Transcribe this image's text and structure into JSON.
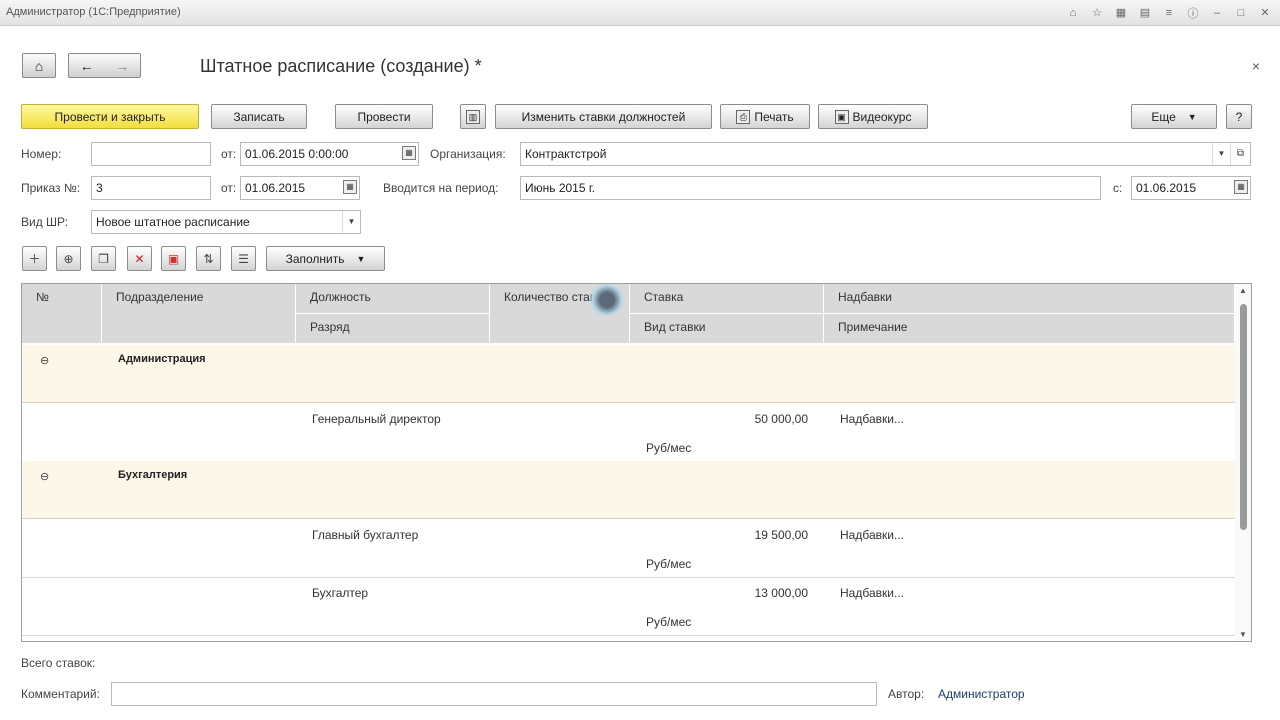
{
  "window": {
    "title": "Администратор  (1С:Предприятие)",
    "tray_icons": [
      "home-icon",
      "star-icon",
      "calculator-icon",
      "calendar-icon",
      "history-icon",
      "info-icon",
      "minimize-icon",
      "maximize-icon",
      "close-icon"
    ]
  },
  "nav": {
    "home": "home-icon",
    "back": "arrow-left-icon",
    "forward": "arrow-right-icon"
  },
  "document": {
    "title": "Штатное расписание (создание) *",
    "close": "×"
  },
  "toolbar": {
    "post_close": "Провести и закрыть",
    "save": "Записать",
    "post": "Провести",
    "change_rates": "Изменить ставки должностей",
    "print": "Печать",
    "video": "Видеокурс",
    "more": "Еще",
    "help": "?"
  },
  "form": {
    "number_label": "Номер:",
    "number_value": "",
    "from_label": "от:",
    "from_value": "01.06.2015  0:00:00",
    "org_label": "Организация:",
    "org_value": "Контрактстрой",
    "order_label": "Приказ №:",
    "order_value": "3",
    "order_from_label": "от:",
    "order_from_value": "01.06.2015",
    "period_label": "Вводится на период:",
    "period_value": "Июнь 2015 г.",
    "since_label": "с:",
    "since_value": "01.06.2015",
    "type_label": "Вид ШР:",
    "type_value": "Новое штатное расписание"
  },
  "table_toolbar": {
    "icons": [
      "add-row-icon",
      "add-group-icon",
      "copy-row-icon",
      "delete-row-icon",
      "close-position-icon",
      "move-icon",
      "list-icon"
    ],
    "fill": "Заполнить"
  },
  "table": {
    "headers": {
      "num": "№",
      "dept": "Подразделение",
      "position": "Должность",
      "grade": "Разряд",
      "count": "Количество ставок",
      "rate": "Ставка",
      "rate_kind": "Вид ставки",
      "bonuses": "Надбавки",
      "note": "Примечание"
    },
    "groups": [
      {
        "name": "Администрация",
        "rows": [
          {
            "position": "Генеральный директор",
            "rate": "50 000,00",
            "bonus": "Надбавки...",
            "kind": "Руб/мес"
          }
        ]
      },
      {
        "name": "Бухгалтерия",
        "rows": [
          {
            "position": "Главный бухгалтер",
            "rate": "19 500,00",
            "bonus": "Надбавки...",
            "kind": "Руб/мес"
          },
          {
            "position": "Бухгалтер",
            "rate": "13 000,00",
            "bonus": "Надбавки...",
            "kind": "Руб/мес"
          }
        ]
      }
    ]
  },
  "footer": {
    "total_label": "Всего ставок:",
    "comment_label": "Комментарий:",
    "comment_value": "",
    "author_label": "Автор:",
    "author_value": "Администратор"
  }
}
